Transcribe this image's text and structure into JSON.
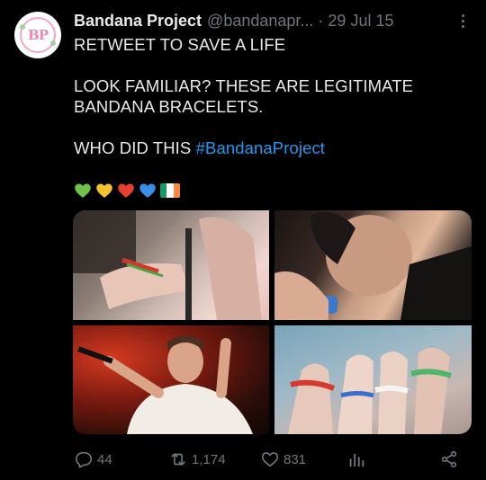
{
  "account": {
    "avatar_initials": "BP",
    "name": "Bandana Project",
    "handle": "@bandanapr...",
    "separator": "·",
    "date": "29 Jul 15"
  },
  "tweet": {
    "line1": "RETWEET TO SAVE A LIFE",
    "line2": "LOOK FAMILIAR? THESE ARE LEGITIMATE",
    "line3": "BANDANA BRACELETS.",
    "line4_text": "WHO DID THIS ",
    "hashtag": "#BandanaProject",
    "emojis": [
      "green-heart",
      "yellow-heart",
      "red-heart",
      "blue-heart",
      "ireland-flag"
    ]
  },
  "media": {
    "photos": [
      "wrists-with-bracelets",
      "singer-close-up",
      "performer-on-stage",
      "raised-wrists-with-bracelets"
    ]
  },
  "actions": {
    "replies": "44",
    "retweets": "1,174",
    "likes": "831"
  },
  "colors": {
    "background": "#000000",
    "text": "#e7e9ea",
    "muted": "#71767b",
    "link": "#1d9bf0"
  }
}
